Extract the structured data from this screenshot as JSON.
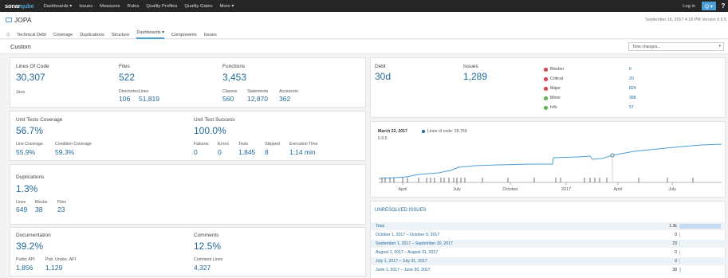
{
  "topbar": {
    "logo_main": "sonar",
    "logo_accent": "qube",
    "nav": [
      "Dashboards ▾",
      "Issues",
      "Measures",
      "Rules",
      "Quality Profiles",
      "Quality Gates",
      "More ▾"
    ],
    "login": "Log in",
    "search_icon": "Q ▾",
    "help_icon": "?"
  },
  "project": {
    "name": "JOPA",
    "date": "September 16, 2017 4:18 PM  Version 0.9.5",
    "tabs": [
      "Technical Debt",
      "Coverage",
      "Duplications",
      "Structure",
      "Dashboards ▾",
      "Components",
      "Issues"
    ]
  },
  "custom": {
    "title": "Custom",
    "time_changes": "Time changes..."
  },
  "size": {
    "loc_label": "Lines Of Code",
    "loc": "30,307",
    "lang": "Java",
    "files_label": "Files",
    "files": "522",
    "dirs_label": "Directories",
    "dirs": "106",
    "lines_label": "Lines",
    "lines": "51,819",
    "functions_label": "Functions",
    "functions": "3,453",
    "classes_label": "Classes",
    "classes": "560",
    "statements_label": "Statements",
    "statements": "12,870",
    "accessors_label": "Accessors",
    "accessors": "362"
  },
  "coverage": {
    "title": "Unit Tests Coverage",
    "value": "56.7%",
    "line_cov_label": "Line Coverage",
    "line_cov": "55.9%",
    "cond_cov_label": "Condition Coverage",
    "cond_cov": "59.3%",
    "success_title": "Unit Test Success",
    "success": "100.0%",
    "failures_label": "Failures",
    "failures": "0",
    "errors_label": "Errors",
    "errors": "0",
    "tests_label": "Tests",
    "tests": "1,845",
    "skipped_label": "Skipped",
    "skipped": "8",
    "exec_label": "Execution Time",
    "exec": "1:14 min"
  },
  "duplications": {
    "title": "Duplications",
    "value": "1.3%",
    "lines_label": "Lines",
    "lines": "649",
    "blocks_label": "Blocks",
    "blocks": "38",
    "files_label": "Files",
    "files": "23"
  },
  "documentation": {
    "title": "Documentation",
    "value": "39.2%",
    "public_api_label": "Public API",
    "public_api": "1,856",
    "undoc_label": "Pub. Undoc. API",
    "undoc": "1,129",
    "comments_title": "Comments",
    "comments": "12.5%",
    "comment_lines_label": "Comment Lines",
    "comment_lines": "4,327"
  },
  "debt": {
    "debt_label": "Debt",
    "debt": "30d",
    "issues_label": "Issues",
    "issues": "1,289",
    "severities": [
      {
        "name": "Blocker",
        "count": "0",
        "color": "#d4333f",
        "icon": "blocker-icon"
      },
      {
        "name": "Critical",
        "count": "20",
        "color": "#d4333f",
        "icon": "critical-icon"
      },
      {
        "name": "Major",
        "count": "824",
        "color": "#d4333f",
        "icon": "major-icon"
      },
      {
        "name": "Minor",
        "count": "388",
        "color": "#4eab3f",
        "icon": "minor-icon"
      },
      {
        "name": "Info",
        "count": "57",
        "color": "#4eab3f",
        "icon": "info-icon"
      }
    ]
  },
  "timeline": {
    "date": "March 22, 2017",
    "legend": "Lines of code: 28,759",
    "version": "0.9.5",
    "ticks": [
      "April",
      "July",
      "October",
      "2017",
      "April",
      "July"
    ]
  },
  "unresolved": {
    "title": "UNRESOLVED ISSUES",
    "rows": [
      {
        "label": "Total",
        "count": "1.3k",
        "fraction": 1.0
      },
      {
        "label": "October 1, 2017 – October 9, 2017",
        "count": "0",
        "fraction": 0
      },
      {
        "label": "September 1, 2017 – September 30, 2017",
        "count": "23",
        "fraction": 0.018
      },
      {
        "label": "August 1, 2017 – August 31, 2017",
        "count": "0",
        "fraction": 0
      },
      {
        "label": "July 1, 2017 – July 31, 2017",
        "count": "0",
        "fraction": 0
      },
      {
        "label": "June 1, 2017 – June 30, 2017",
        "count": "38",
        "fraction": 0.03
      }
    ]
  },
  "colors": {
    "accent": "#4b9fd5",
    "link": "#236a97",
    "topbar": "#262626"
  }
}
